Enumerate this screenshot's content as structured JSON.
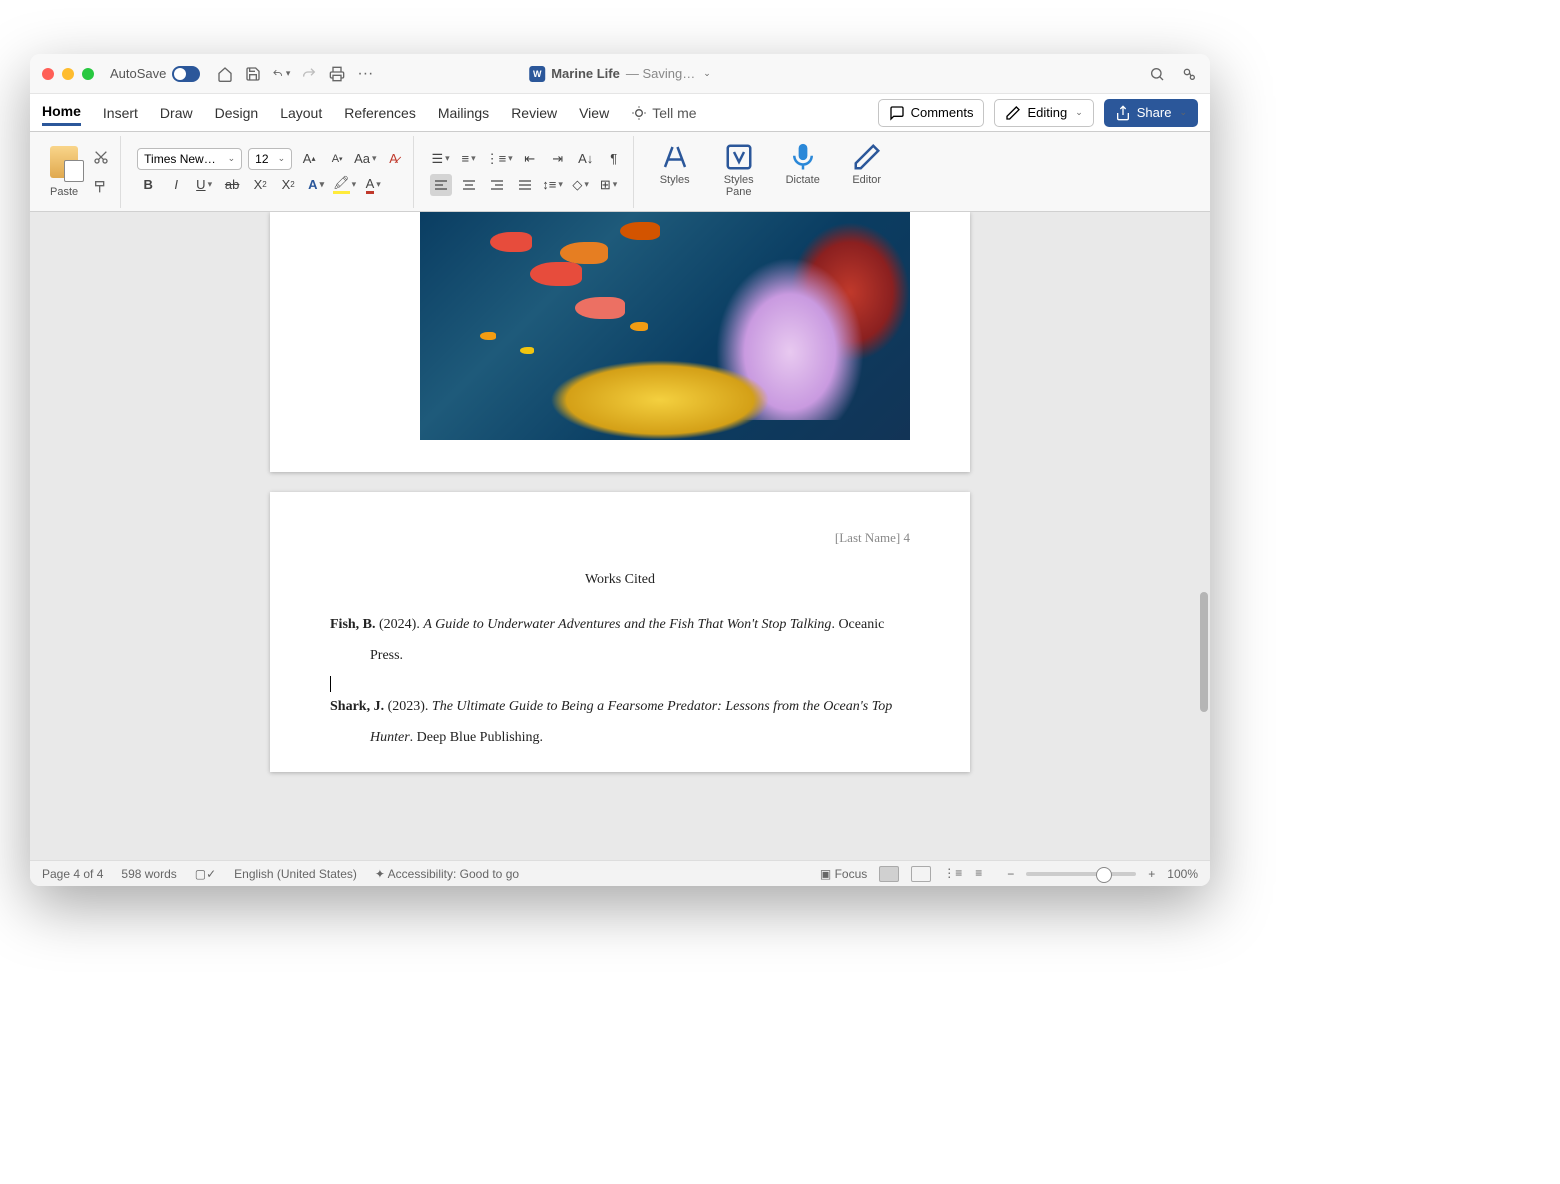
{
  "titlebar": {
    "autosave": "AutoSave",
    "doc_name": "Marine Life",
    "doc_status": "— Saving…"
  },
  "tabs": {
    "items": [
      "Home",
      "Insert",
      "Draw",
      "Design",
      "Layout",
      "References",
      "Mailings",
      "Review",
      "View"
    ],
    "tellme": "Tell me",
    "comments": "Comments",
    "editing": "Editing",
    "share": "Share"
  },
  "ribbon": {
    "paste": "Paste",
    "font_name": "Times New…",
    "font_size": "12",
    "styles": "Styles",
    "styles_pane": "Styles Pane",
    "dictate": "Dictate",
    "editor": "Editor"
  },
  "document": {
    "header": "[Last Name] 4",
    "works_cited_title": "Works Cited",
    "entries": [
      {
        "author": "Fish, B.",
        "year": "(2024).",
        "title": "A Guide to Underwater Adventures and the Fish That Won't Stop Talking",
        "publisher": ". Oceanic Press."
      },
      {
        "author": "Shark, J.",
        "year": "(2023).",
        "title": "The Ultimate Guide to Being a Fearsome Predator: Lessons from the Ocean's Top Hunter",
        "publisher": ". Deep Blue Publishing."
      }
    ]
  },
  "statusbar": {
    "page": "Page 4 of 4",
    "words": "598 words",
    "lang": "English (United States)",
    "accessibility": "Accessibility: Good to go",
    "focus": "Focus",
    "zoom": "100%"
  }
}
